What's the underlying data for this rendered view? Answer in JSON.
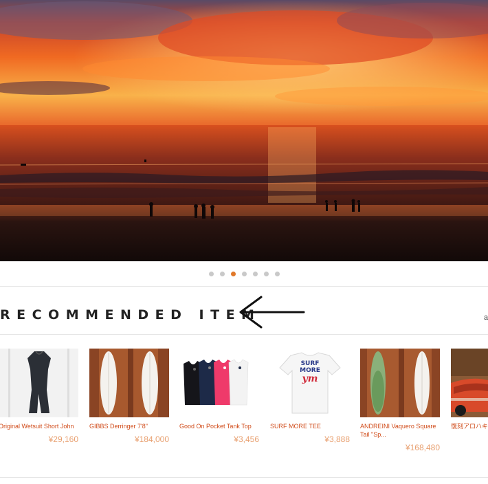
{
  "hero": {
    "image": "sunset-beach-surfers-photo"
  },
  "carousel": {
    "total": 7,
    "active_index": 2
  },
  "section": {
    "title": "RECOMMENDED ITEM",
    "more_link": "a"
  },
  "colors": {
    "accent": "#e0782a",
    "product_name": "#d04a18",
    "price": "#e8a070"
  },
  "products": [
    {
      "name": "Original Wetsuit Short John",
      "price": "¥29,160",
      "image": "wetsuit-photo"
    },
    {
      "name": "GIBBS Derringer 7'8\"",
      "price": "¥184,000",
      "image": "surfboards-photo"
    },
    {
      "name": "Good On Pocket Tank Top",
      "price": "¥3,456",
      "image": "tank-tops-photo"
    },
    {
      "name": "SURF MORE TEE",
      "price": "¥3,888",
      "image": "tshirt-photo",
      "print": [
        "SURF",
        "MORE",
        "ym"
      ]
    },
    {
      "name": "ANDREINI Vaquero Square Tail \"Sp...",
      "price": "¥168,480",
      "image": "green-surfboard-photo"
    },
    {
      "name": "復刻アロハキ",
      "price": "",
      "image": "car-photo"
    }
  ]
}
